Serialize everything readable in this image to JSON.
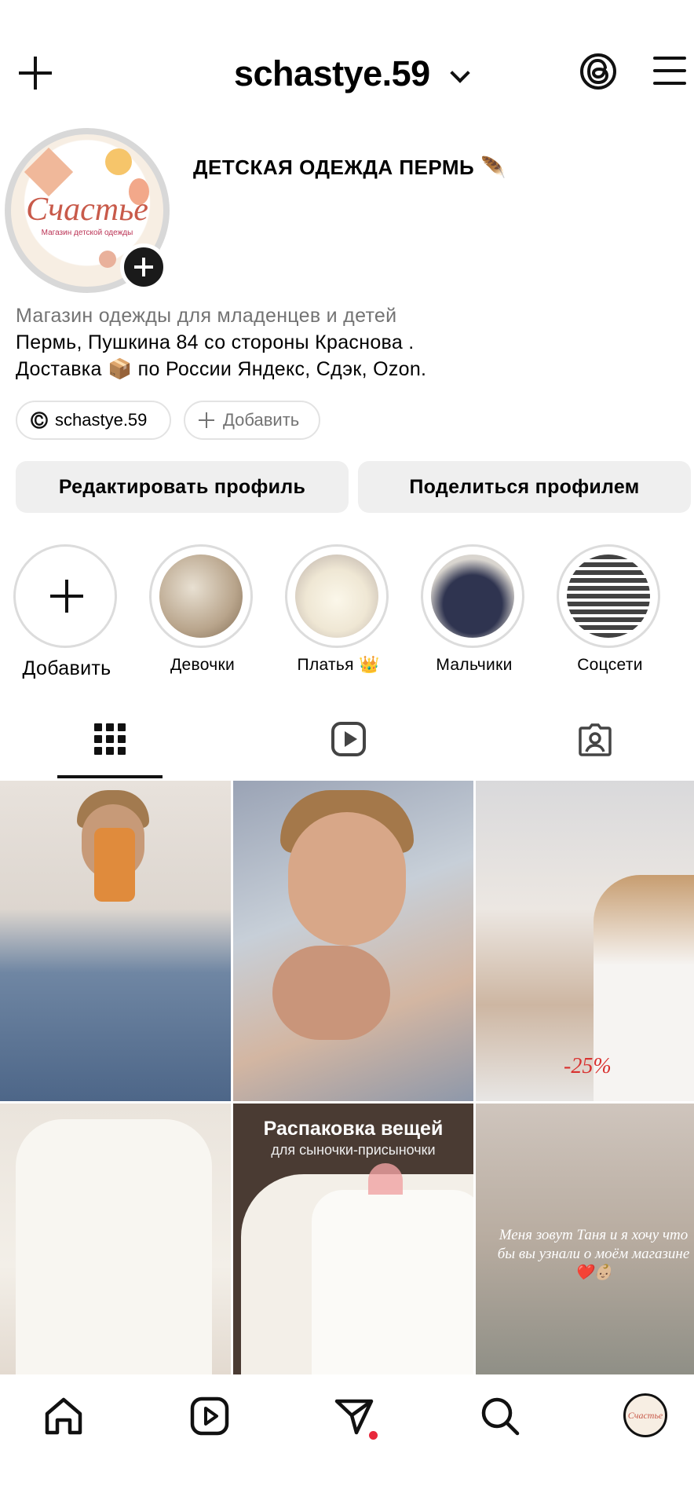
{
  "header": {
    "username": "schastye.59"
  },
  "profile": {
    "business_name": "ДЕТСКАЯ ОДЕЖДА ПЕРМЬ 🪶",
    "avatar_logo": "Счастье",
    "avatar_subtitle": "Магазин детской одежды",
    "category": "Магазин одежды для младенцев и детей",
    "bio_line1": "Пермь, Пушкина 84 со стороны Краснова .",
    "bio_line2": "Доставка 📦 по России Яндекс, Сдэк, Ozon.",
    "threads_pill": "schastye.59",
    "add_pill": "Добавить"
  },
  "buttons": {
    "edit": "Редактировать профиль",
    "share": "Поделиться профилем"
  },
  "highlights": [
    {
      "label": "Добавить"
    },
    {
      "label": "Девочки",
      "color": "#b9a58c"
    },
    {
      "label": "Платья 👑",
      "color": "#efe7d4"
    },
    {
      "label": "Мальчики",
      "color": "#2f3450"
    },
    {
      "label": "Соцсети",
      "color": "#e9e9e9"
    }
  ],
  "tabs": [
    "grid-icon",
    "reels-icon",
    "tagged-icon"
  ],
  "posts": {
    "p3_text": "-25%",
    "p5_title": "Распаковка вещей",
    "p5_subtitle": "для сыночки-присыночки",
    "p6_text": "Меня зовут Таня и я хочу что бы вы узнали о моём магазине ❤️👶🏼"
  },
  "bottom_nav": [
    "home-icon",
    "reels-icon",
    "direct-icon",
    "search-icon",
    "profile-avatar"
  ],
  "colors": {
    "notification_dot": "#e8283c",
    "secondary_text": "#737373",
    "button_bg": "#efefef"
  }
}
